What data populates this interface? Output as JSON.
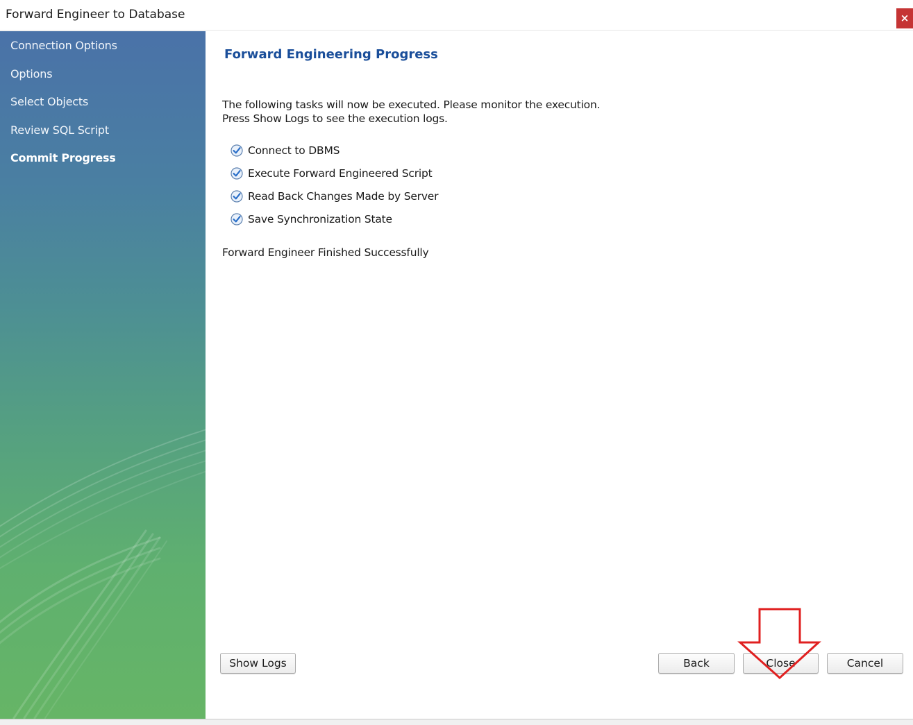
{
  "window": {
    "title": "Forward Engineer to Database",
    "close_glyph": "×"
  },
  "sidebar": {
    "items": [
      {
        "label": "Connection Options",
        "active": false
      },
      {
        "label": "Options",
        "active": false
      },
      {
        "label": "Select Objects",
        "active": false
      },
      {
        "label": "Review SQL Script",
        "active": false
      },
      {
        "label": "Commit Progress",
        "active": true
      }
    ]
  },
  "main": {
    "title": "Forward Engineering Progress",
    "intro_line1": "The following tasks will now be executed. Please monitor the execution.",
    "intro_line2": "Press Show Logs to see the execution logs.",
    "tasks": [
      {
        "label": "Connect to DBMS",
        "done": true
      },
      {
        "label": "Execute Forward Engineered Script",
        "done": true
      },
      {
        "label": "Read Back Changes Made by Server",
        "done": true
      },
      {
        "label": "Save Synchronization State",
        "done": true
      }
    ],
    "status": "Forward Engineer Finished Successfully"
  },
  "buttons": {
    "show_logs": "Show Logs",
    "back": "Back",
    "close": "Close",
    "cancel": "Cancel"
  },
  "icons": {
    "check": "check-circle-icon",
    "annotation": "down-arrow-icon"
  },
  "colors": {
    "title_blue": "#1a4e9a",
    "check_blue": "#2a6fc9",
    "annotation_red": "#e02020",
    "close_red": "#c53434"
  }
}
